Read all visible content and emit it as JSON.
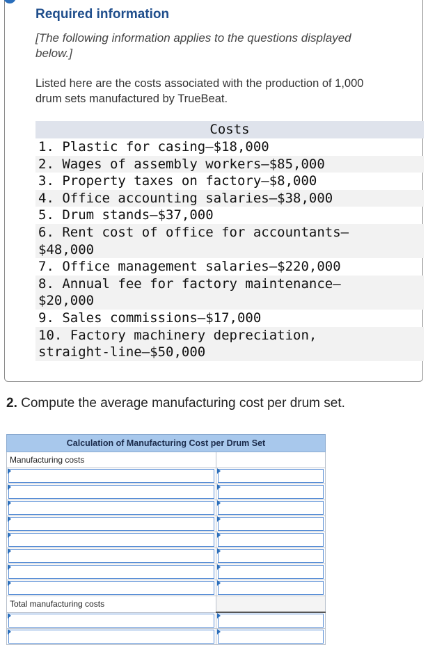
{
  "info": {
    "title": "Required information",
    "note": "[The following information applies to the questions displayed below.]",
    "intro": "Listed here are the costs associated with the production of 1,000 drum sets manufactured by TrueBeat."
  },
  "costs": {
    "header": "Costs",
    "lines": [
      "1. Plastic for casing—$18,000",
      "2. Wages of assembly workers—$85,000",
      "3. Property taxes on factory—$8,000",
      "4. Office accounting salaries—$38,000",
      "5. Drum stands—$37,000",
      "6. Rent cost of office for accountants—",
      "$48,000",
      "7. Office management salaries—$220,000",
      "8. Annual fee for factory maintenance—",
      "$20,000",
      "9. Sales commissions—$17,000",
      "10. Factory machinery depreciation,",
      "straight-line—$50,000"
    ]
  },
  "question": {
    "number": "2.",
    "text": " Compute the average manufacturing cost per drum set."
  },
  "calc": {
    "title": "Calculation of Manufacturing Cost per Drum Set",
    "section_label": "Manufacturing costs",
    "total_label": "Total manufacturing costs"
  }
}
